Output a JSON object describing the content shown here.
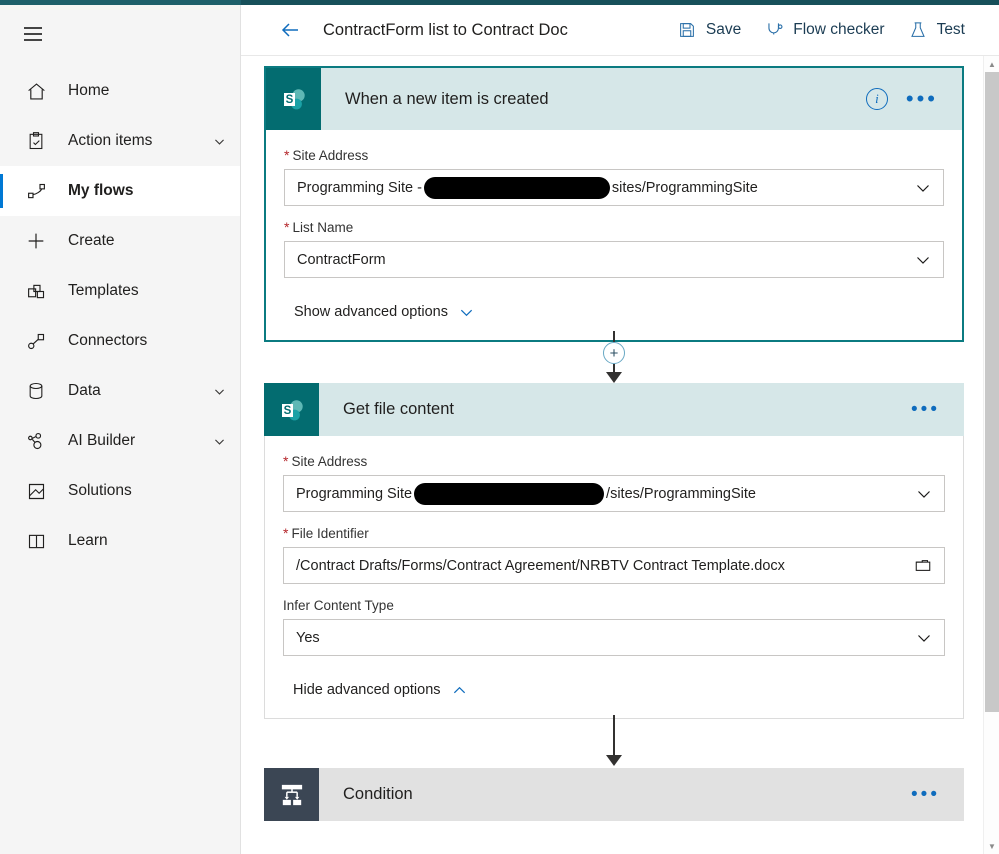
{
  "colors": {
    "accent_blue": "#0078d4",
    "sharepoint_teal": "#036c70",
    "card_header_teal": "#d6e7e8",
    "selected_border": "#0b7b81",
    "condition_dark": "#3b4654",
    "required_red": "#b4252a",
    "top_strip": "#17505a"
  },
  "sidebar": {
    "menu_button": "hamburger-menu",
    "items": [
      {
        "label": "Home",
        "icon": "home-icon",
        "expandable": false,
        "selected": false
      },
      {
        "label": "Action items",
        "icon": "clipboard-check-icon",
        "expandable": true,
        "selected": false
      },
      {
        "label": "My flows",
        "icon": "flow-icon",
        "expandable": false,
        "selected": true
      },
      {
        "label": "Create",
        "icon": "plus-icon",
        "expandable": false,
        "selected": false
      },
      {
        "label": "Templates",
        "icon": "templates-icon",
        "expandable": false,
        "selected": false
      },
      {
        "label": "Connectors",
        "icon": "connectors-icon",
        "expandable": false,
        "selected": false
      },
      {
        "label": "Data",
        "icon": "database-icon",
        "expandable": true,
        "selected": false
      },
      {
        "label": "AI Builder",
        "icon": "ai-builder-icon",
        "expandable": true,
        "selected": false
      },
      {
        "label": "Solutions",
        "icon": "solutions-icon",
        "expandable": false,
        "selected": false
      },
      {
        "label": "Learn",
        "icon": "book-icon",
        "expandable": false,
        "selected": false
      }
    ]
  },
  "commandbar": {
    "back_label": "back-arrow",
    "title": "ContractForm list to Contract Doc",
    "actions": [
      {
        "label": "Save",
        "icon": "save-icon"
      },
      {
        "label": "Flow checker",
        "icon": "stethoscope-icon"
      },
      {
        "label": "Test",
        "icon": "flask-icon"
      }
    ]
  },
  "flow": {
    "steps": [
      {
        "title": "When a new item is created",
        "connector": "SharePoint",
        "icon": "sharepoint-icon",
        "selected": true,
        "has_info_icon": true,
        "menu": "•••",
        "fields": [
          {
            "label": "Site Address",
            "required": true,
            "value_prefix": "Programming Site - ",
            "redacted": true,
            "value_suffix": "sites/ProgrammingSite",
            "control": "dropdown"
          },
          {
            "label": "List Name",
            "required": true,
            "value_prefix": "ContractForm",
            "redacted": false,
            "value_suffix": "",
            "control": "dropdown"
          }
        ],
        "advanced_toggle": {
          "label": "Show advanced options",
          "state": "collapsed"
        }
      },
      {
        "title": "Get file content",
        "connector": "SharePoint",
        "icon": "sharepoint-icon",
        "selected": false,
        "has_info_icon": false,
        "menu": "•••",
        "fields": [
          {
            "label": "Site Address",
            "required": true,
            "value_prefix": "Programming Site ",
            "redacted": true,
            "value_suffix": "/sites/ProgrammingSite",
            "control": "dropdown"
          },
          {
            "label": "File Identifier",
            "required": true,
            "value_prefix": "/Contract Drafts/Forms/Contract Agreement/NRBTV Contract Template.docx",
            "redacted": false,
            "value_suffix": "",
            "control": "file-picker"
          },
          {
            "label": "Infer Content Type",
            "required": false,
            "value_prefix": "Yes",
            "redacted": false,
            "value_suffix": "",
            "control": "dropdown"
          }
        ],
        "advanced_toggle": {
          "label": "Hide advanced options",
          "state": "expanded"
        }
      },
      {
        "title": "Condition",
        "connector": "Control",
        "icon": "condition-icon",
        "selected": false,
        "has_info_icon": false,
        "menu": "•••",
        "fields": [],
        "advanced_toggle": null
      }
    ],
    "connectors": [
      {
        "type": "add-step-plus",
        "symbol": "+"
      },
      {
        "type": "arrow",
        "symbol": ""
      }
    ]
  }
}
